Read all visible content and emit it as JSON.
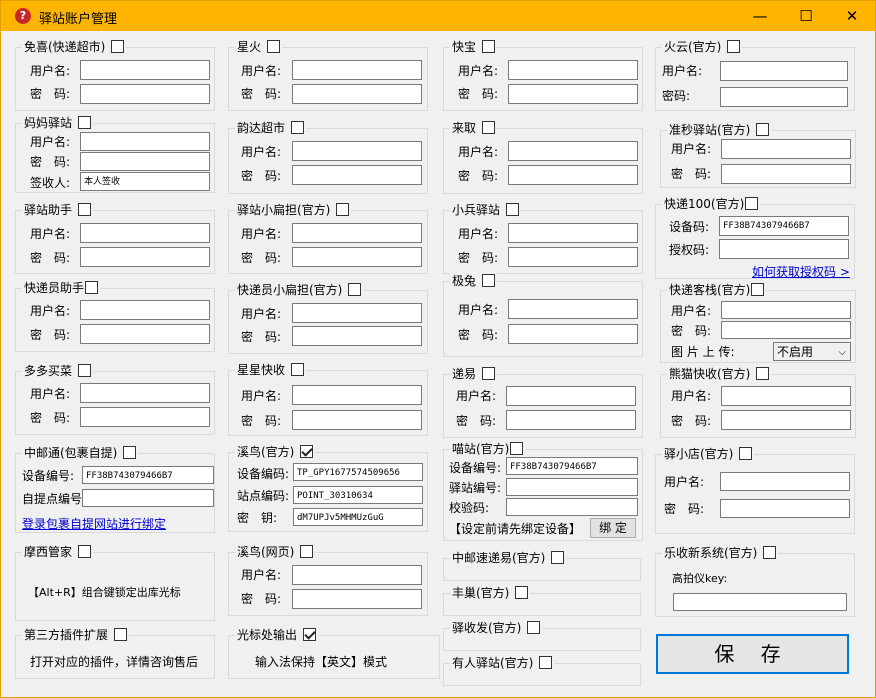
{
  "window": {
    "title": "驿站账户管理",
    "controls": {
      "minimize": "—",
      "maximize": "☐",
      "close": "✕"
    }
  },
  "labels": {
    "user": "用户名:",
    "pwd": "密　码:",
    "pwd2": "密码:",
    "device_code": "设备编号:",
    "device_code2": "设备码:",
    "auth_code": "授权码:",
    "station_code": "驿站编号:",
    "verify_code": "校验码:",
    "device_code_eq": "设备编码:",
    "station_code_eq": "站点编码:",
    "key": "密　钥:",
    "pickup_code": "自提点编号",
    "receiver": "签收人:",
    "pic_upload": "图 片 上 传:",
    "scanner_key": "高拍仪key:"
  },
  "groups": {
    "mianxi": "免喜(快递超市)",
    "xinghuo": "星火",
    "kuaibao": "快宝",
    "huoyun": "火云(官方)",
    "mama": "妈妈驿站",
    "yunda": "韵达超市",
    "laiqu": "来取",
    "zhunmiao": "准秒驿站(官方)",
    "zhushou": "驿站助手",
    "xiaobiandan": "驿站小扁担(官方)",
    "xiaobing": "小兵驿站",
    "kd100": "快递100(官方)",
    "kdyzs": "快递员助手",
    "kdy_bd": "快递员小扁担(官方)",
    "jitu": "极兔",
    "kdkz": "快递客栈(官方)",
    "duoduo": "多多买菜",
    "xingxing": "星星快收",
    "diyi": "递易",
    "xiongmao": "熊猫快收(官方)",
    "zhongyou": "中邮通(包裹自提)",
    "xiniao": "溪鸟(官方)",
    "miaozhan": "喵站(官方)",
    "yixiaodian": "驿小店(官方)",
    "moxi": "摩西管家",
    "xiniao_web": "溪鸟(网页)",
    "zhongyou_su": "中邮速递易(官方)",
    "lexiao": "乐收新系统(官方)",
    "fengchao": "丰巢(官方)",
    "yishoufa": "驿收发(官方)",
    "plugin": "第三方插件扩展",
    "cursor": "光标处输出",
    "youren": "有人驿站(官方)"
  },
  "values": {
    "mama_receiver": "本人签收",
    "kd100_device": "FF38B743079466B7",
    "zhongyou_device": "FF38B743079466B7",
    "xiniao_device": "TP_GPY1677574509656",
    "xiniao_station": "POINT_30310634",
    "xiniao_key": "dM7UPJv5MHMUzGuG",
    "miaozhan_device": "FF38B743079466B7",
    "kdkz_upload": "不启用"
  },
  "checks": {
    "xiniao": true,
    "cursor": true
  },
  "texts": {
    "kd100_link": "如何获取授权码 >",
    "zhongyou_link": "登录包裹自提网站进行绑定",
    "moxi_tip": "【Alt+R】组合键锁定出库光标",
    "plugin_tip": "打开对应的插件，详情咨询售后",
    "cursor_tip": "输入法保持【英文】模式",
    "miaozhan_tip": "【设定前请先绑定设备】",
    "bind": "绑 定",
    "save": "保 存"
  },
  "icons": {
    "app": "app-question-icon"
  }
}
